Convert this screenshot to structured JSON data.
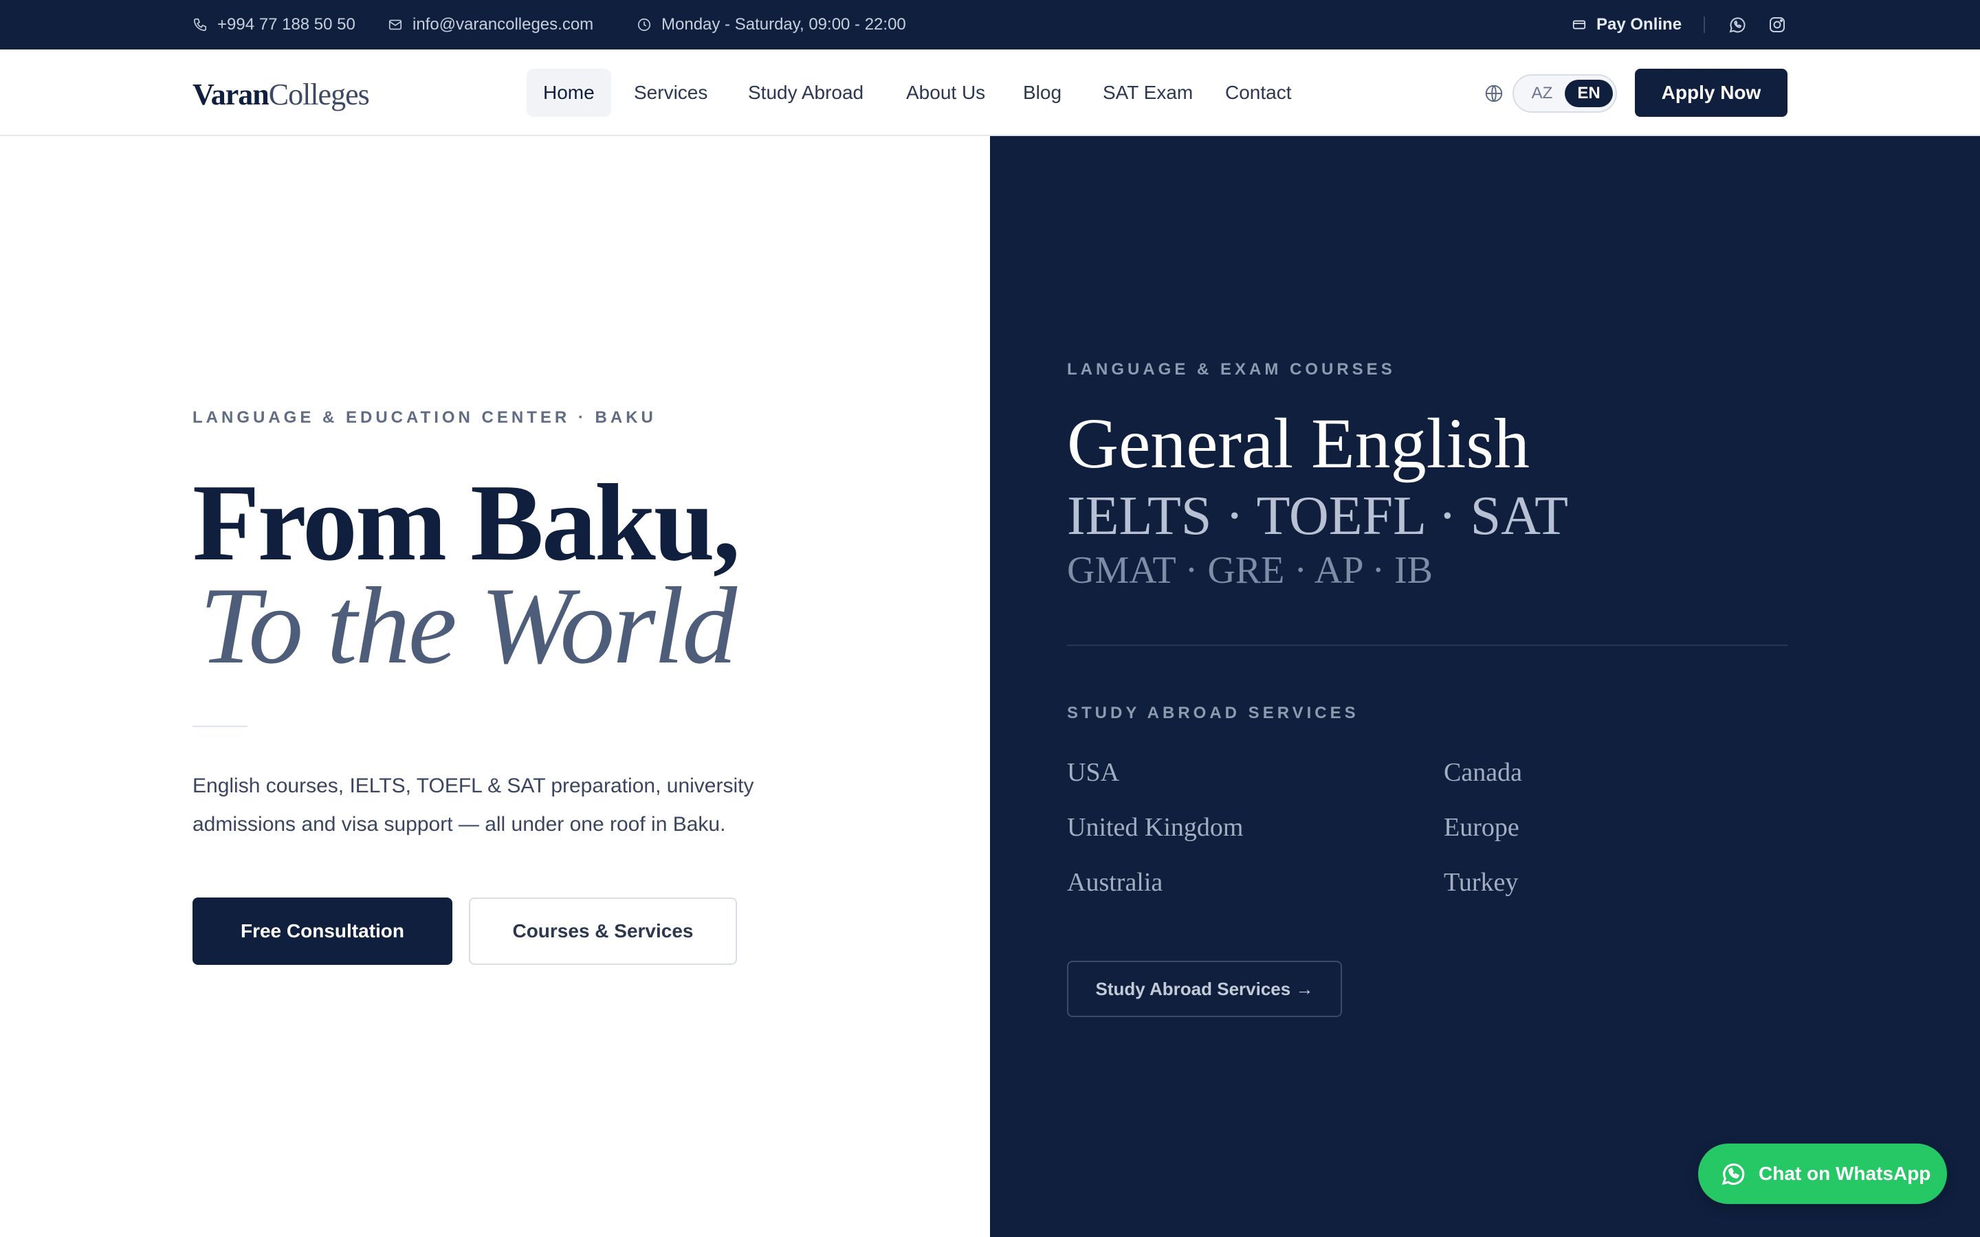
{
  "topbar": {
    "phone": "+994 77 188 50 50",
    "email": "info@varancolleges.com",
    "hours": "Monday - Saturday, 09:00 - 22:00",
    "pay_online": "Pay Online",
    "icons": [
      "phone-icon",
      "mail-icon",
      "clock-icon",
      "credit-card-icon",
      "whatsapp-icon",
      "instagram-icon"
    ]
  },
  "header": {
    "logo_bold": "Varan",
    "logo_light": "Colleges",
    "nav": [
      {
        "label": "Home",
        "active": true
      },
      {
        "label": "Services",
        "active": false
      },
      {
        "label": "Study Abroad",
        "active": false
      },
      {
        "label": "About Us",
        "active": false
      },
      {
        "label": "Blog",
        "active": false
      },
      {
        "label": "SAT Exam",
        "active": false
      },
      {
        "label": "Contact",
        "active": false
      }
    ],
    "lang": {
      "options": [
        "AZ",
        "EN"
      ],
      "selected": "EN"
    },
    "apply_label": "Apply Now"
  },
  "hero": {
    "eyebrow": "LANGUAGE & EDUCATION CENTER · BAKU",
    "title_line1": "From Baku,",
    "title_line2": "To the World",
    "lead": "English courses, IELTS, TOEFL & SAT preparation, university admissions and visa support — all under one roof in Baku.",
    "primary_cta": "Free Consultation",
    "secondary_cta": "Courses & Services"
  },
  "panel": {
    "courses_eyebrow": "LANGUAGE & EXAM COURSES",
    "course_line1": "General English",
    "course_line2": "IELTS · TOEFL · SAT",
    "course_line3": "GMAT · GRE · AP · IB",
    "study_eyebrow": "STUDY ABROAD SERVICES",
    "countries": [
      "USA",
      "Canada",
      "United Kingdom",
      "Europe",
      "Australia",
      "Turkey"
    ],
    "study_cta": "Study Abroad Services →"
  },
  "whatsapp": {
    "label": "Chat on WhatsApp"
  },
  "colors": {
    "navy": "#0f1f3d",
    "whatsapp_green": "#25c864",
    "muted_title": "#4d5d7a"
  }
}
